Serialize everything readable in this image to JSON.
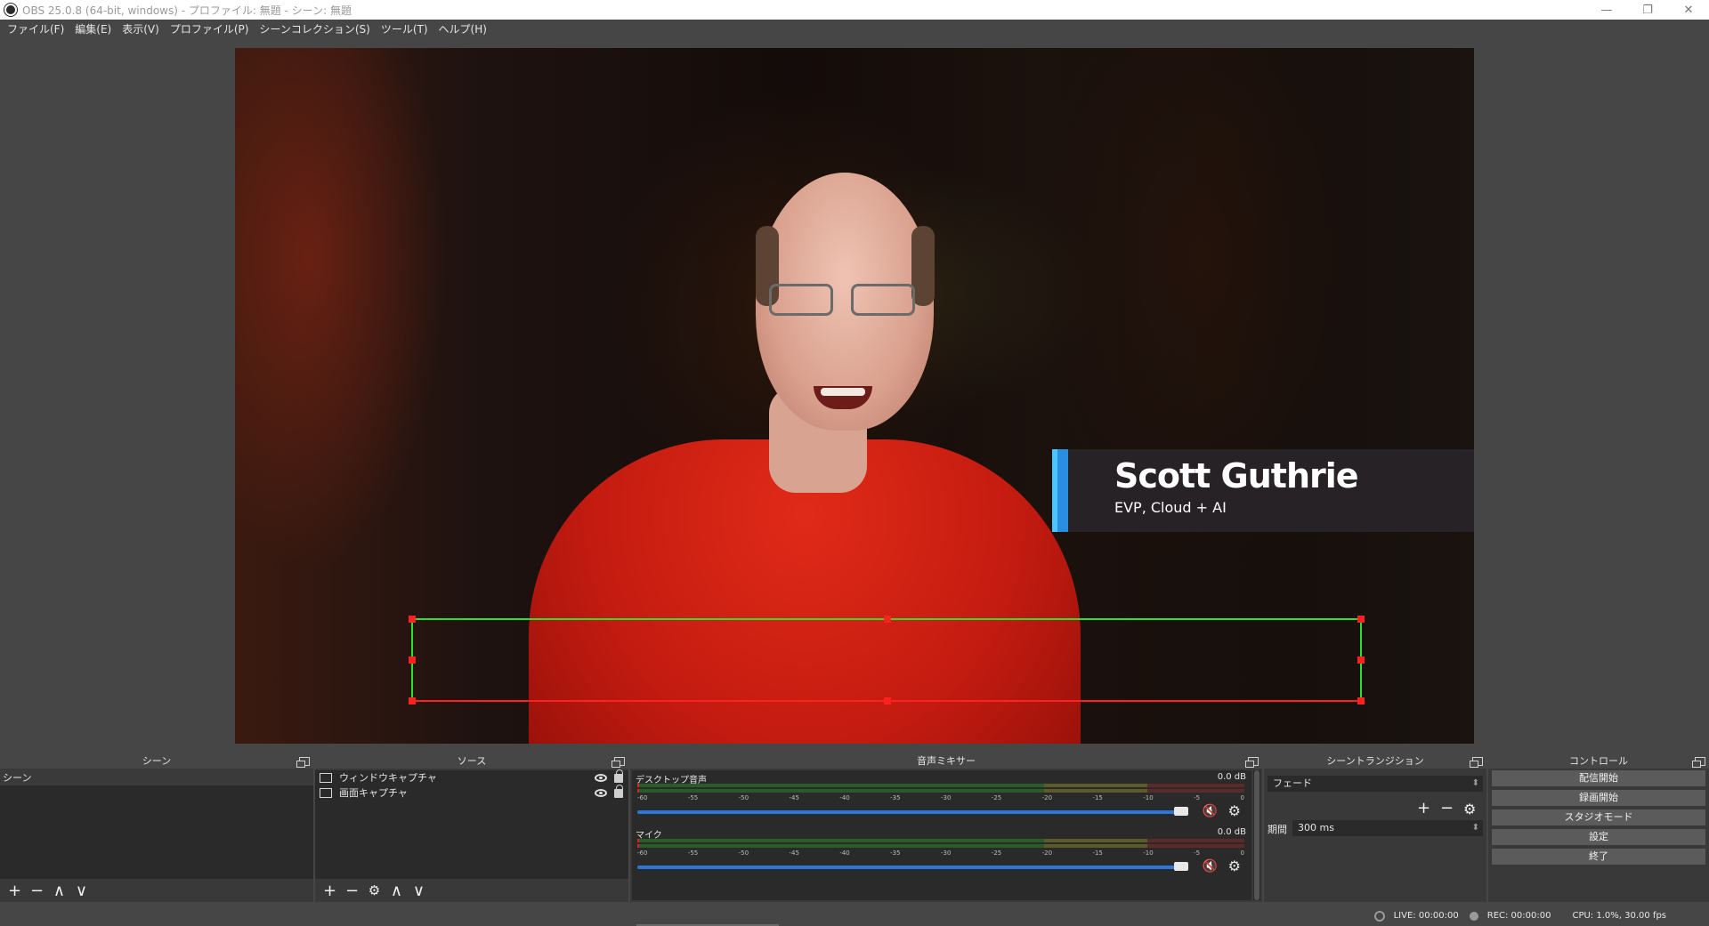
{
  "window": {
    "title": "OBS 25.0.8 (64-bit, windows) - プロファイル: 無題 - シーン: 無題",
    "minimize": "—",
    "restore": "❐",
    "close": "✕"
  },
  "menu": [
    "ファイル(F)",
    "編集(E)",
    "表示(V)",
    "プロファイル(P)",
    "シーンコレクション(S)",
    "ツール(T)",
    "ヘルプ(H)"
  ],
  "preview": {
    "lower_third": {
      "name": "Scott Guthrie",
      "role": "EVP, Cloud + AI"
    }
  },
  "scenes": {
    "title": "シーン",
    "items": [
      "シーン"
    ],
    "toolbar": [
      "+",
      "−",
      "∧",
      "∨"
    ]
  },
  "sources": {
    "title": "ソース",
    "items": [
      {
        "label": "ウィンドウキャプチャ"
      },
      {
        "label": "画面キャプチャ"
      }
    ],
    "toolbar": [
      "+",
      "−",
      "⚙",
      "∧",
      "∨"
    ]
  },
  "mixer": {
    "title": "音声ミキサー",
    "scale": [
      "-60",
      "-55",
      "-50",
      "-45",
      "-40",
      "-35",
      "-30",
      "-25",
      "-20",
      "-15",
      "-10",
      "-5",
      "0"
    ],
    "channels": [
      {
        "name": "デスクトップ音声",
        "db": "0.0 dB",
        "volume_fraction": 1.0
      },
      {
        "name": "マイク",
        "db": "0.0 dB",
        "volume_fraction": 1.0
      }
    ]
  },
  "transitions": {
    "title": "シーントランジション",
    "selected": "フェード",
    "duration_label": "期間",
    "duration_value": "300 ms",
    "buttons": [
      "+",
      "−",
      "⚙"
    ]
  },
  "controls": {
    "title": "コントロール",
    "buttons": [
      "配信開始",
      "録画開始",
      "スタジオモード",
      "設定",
      "終了"
    ]
  },
  "status": {
    "live": "LIVE: 00:00:00",
    "rec": "REC: 00:00:00",
    "cpu": "CPU: 1.0%, 30.00 fps"
  },
  "colors": {
    "background": "#464646",
    "panel": "#393939",
    "list": "#2a2a2a",
    "accent_blue": "#2c78d8",
    "selection_green": "#2ee02e",
    "handle_red": "#ff2020",
    "lower_third_bar": "#4fc3ff"
  }
}
